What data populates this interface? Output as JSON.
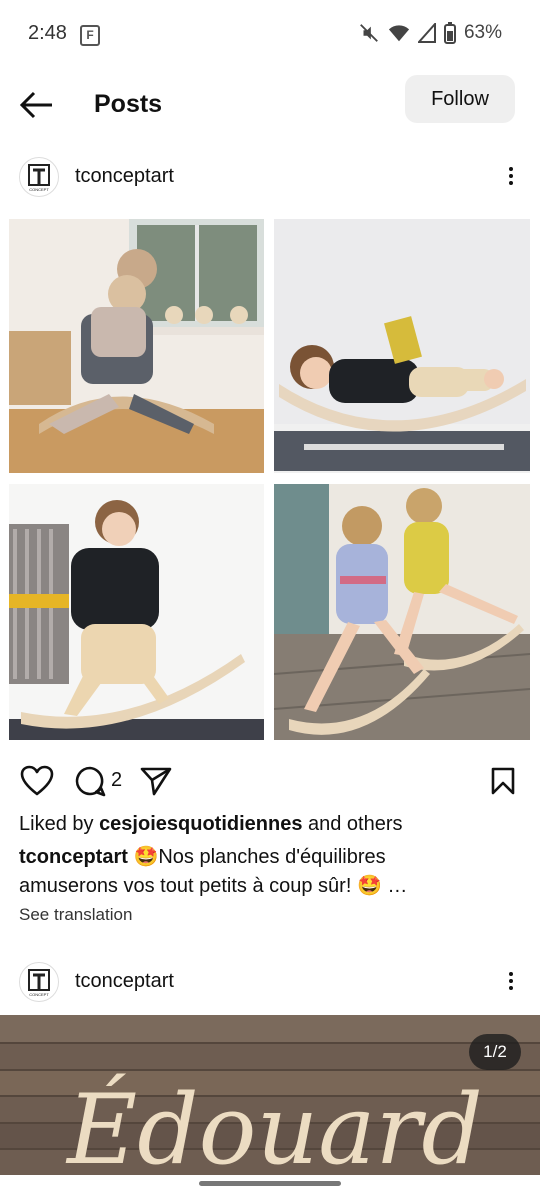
{
  "status": {
    "time": "2:48",
    "badge": "F",
    "battery": "63%"
  },
  "header": {
    "title": "Posts",
    "follow_label": "Follow"
  },
  "post1": {
    "username": "tconceptart",
    "comment_count": "2",
    "liked_prefix": "Liked by ",
    "liked_user": "cesjoiesquotidiennes",
    "liked_suffix": " and others",
    "caption_user": "tconceptart",
    "caption_line1": " 🤩Nos planches d'équilibres",
    "caption_line2": "amuserons vos tout petits à coup sûr! 🤩 …",
    "see_translation": "See translation"
  },
  "post2": {
    "username": "tconceptart",
    "page_counter": "1/2",
    "image_text": "Édouard"
  },
  "avatar_text": "CONCEPT",
  "icons": [
    "back-arrow-icon",
    "more-options-icon",
    "heart-icon",
    "comment-icon",
    "share-icon",
    "bookmark-icon",
    "mute-icon",
    "wifi-icon",
    "signal-icon",
    "battery-icon"
  ],
  "colors": {
    "follow_bg": "#efefef",
    "text": "#111111",
    "counter_bg": "#1e1e1e"
  }
}
